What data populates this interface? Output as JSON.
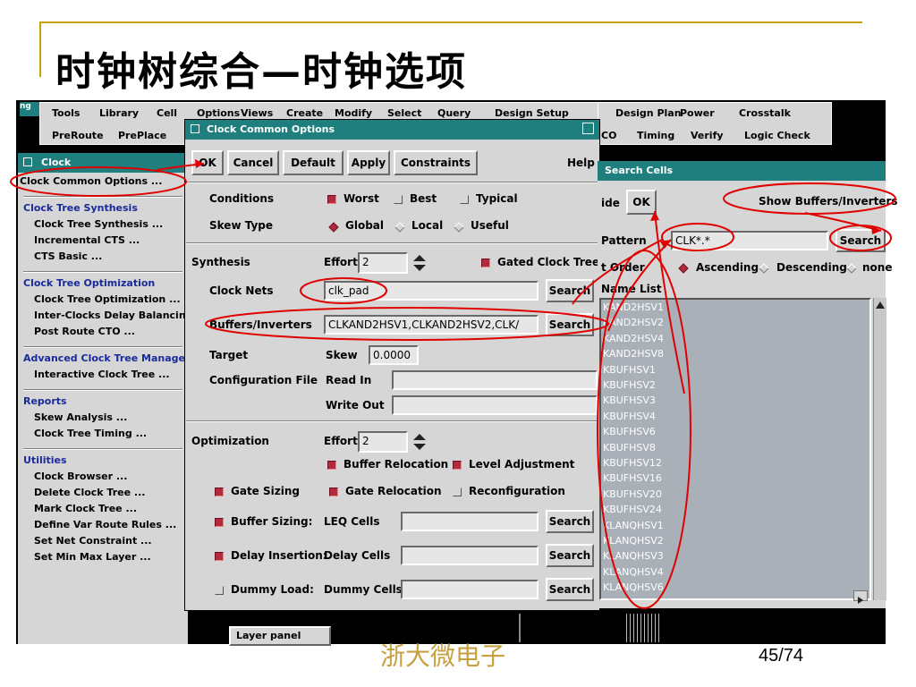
{
  "slide": {
    "title": "时钟树综合—时钟选项",
    "footer": "浙大微电子",
    "page": "45/74"
  },
  "main_menu": {
    "row1": [
      "Tools",
      "Library",
      "Cell",
      "Options",
      "Views",
      "Create",
      "Modify",
      "Select",
      "Query",
      "Design Setup",
      "Design Plan",
      "Power",
      "Crosstalk"
    ],
    "row2": [
      "PreRoute",
      "PrePlace",
      "CO",
      "Timing",
      "Verify",
      "Logic Check"
    ]
  },
  "clock_menu": {
    "title": "Clock",
    "items": [
      {
        "type": "item",
        "label": "Clock Common Options ..."
      },
      {
        "type": "sep"
      },
      {
        "type": "header",
        "label": "Clock Tree Synthesis"
      },
      {
        "type": "item",
        "label": "Clock Tree Synthesis ..."
      },
      {
        "type": "item",
        "label": "Incremental CTS ..."
      },
      {
        "type": "item",
        "label": "CTS Basic ..."
      },
      {
        "type": "sep"
      },
      {
        "type": "header",
        "label": "Clock Tree Optimization"
      },
      {
        "type": "item",
        "label": "Clock Tree Optimization ..."
      },
      {
        "type": "item",
        "label": "Inter-Clocks Delay Balancing"
      },
      {
        "type": "item",
        "label": "Post Route CTO ..."
      },
      {
        "type": "sep"
      },
      {
        "type": "header",
        "label": "Advanced Clock Tree Managen"
      },
      {
        "type": "item",
        "label": "Interactive Clock Tree ..."
      },
      {
        "type": "sep"
      },
      {
        "type": "header",
        "label": "Reports"
      },
      {
        "type": "item",
        "label": "Skew Analysis ..."
      },
      {
        "type": "item",
        "label": "Clock Tree Timing ..."
      },
      {
        "type": "sep"
      },
      {
        "type": "header",
        "label": "Utilities"
      },
      {
        "type": "item",
        "label": "Clock Browser ..."
      },
      {
        "type": "item",
        "label": "Delete Clock Tree ..."
      },
      {
        "type": "item",
        "label": "Mark Clock Tree ..."
      },
      {
        "type": "item",
        "label": "Define Var Route Rules ..."
      },
      {
        "type": "item",
        "label": "Set Net Constraint ..."
      },
      {
        "type": "item",
        "label": "Set Min Max Layer ..."
      }
    ]
  },
  "dialog": {
    "title": "Clock Common Options",
    "buttons": {
      "ok": "OK",
      "cancel": "Cancel",
      "default": "Default",
      "apply": "Apply",
      "constraints": "Constraints",
      "help": "Help"
    },
    "conditions": {
      "label": "Conditions",
      "worst": "Worst",
      "best": "Best",
      "typical": "Typical"
    },
    "skew_type": {
      "label": "Skew Type",
      "global": "Global",
      "local": "Local",
      "useful": "Useful"
    },
    "synthesis": {
      "label": "Synthesis",
      "effort_label": "Effort",
      "effort_value": "2",
      "gated": "Gated Clock Tree"
    },
    "clock_nets": {
      "label": "Clock Nets",
      "value": "clk_pad",
      "search": "Search"
    },
    "buffers": {
      "label": "Buffers/Inverters",
      "value": "CLKAND2HSV1,CLKAND2HSV2,CLK/",
      "search": "Search"
    },
    "target": {
      "label": "Target",
      "skew_label": "Skew",
      "skew_value": "0.0000"
    },
    "config": {
      "label": "Configuration File",
      "read_in": "Read In",
      "write_out": "Write Out"
    },
    "optimization": {
      "label": "Optimization",
      "effort_label": "Effort",
      "effort_value": "2",
      "buffer_relocation": "Buffer Relocation",
      "level_adjustment": "Level Adjustment"
    },
    "gate_sizing": {
      "label": "Gate Sizing",
      "gate_relocation": "Gate Relocation",
      "reconfiguration": "Reconfiguration"
    },
    "buffer_sizing": {
      "label": "Buffer Sizing:",
      "cells": "LEQ Cells",
      "search": "Search"
    },
    "delay_insertion": {
      "label": "Delay Insertion:",
      "cells": "Delay Cells",
      "search": "Search"
    },
    "dummy_load": {
      "label": "Dummy Load:",
      "cells": "Dummy Cells",
      "search": "Search"
    }
  },
  "search_cells": {
    "title": "Search Cells",
    "hide": "ide",
    "ok": "OK",
    "show_buffers": "Show Buffers/Inverters",
    "pattern_label": "Pattern",
    "pattern_value": "CLK*.*",
    "search": "Search",
    "sort_label": "t Order",
    "ascending": "Ascending",
    "descending": "Descending",
    "none": "none",
    "list_label": "Name List",
    "items": [
      "KAND2HSV1",
      "KAND2HSV2",
      "KAND2HSV4",
      "KAND2HSV8",
      "KBUFHSV1",
      "KBUFHSV2",
      "KBUFHSV3",
      "KBUFHSV4",
      "KBUFHSV6",
      "KBUFHSV8",
      "KBUFHSV12",
      "KBUFHSV16",
      "KBUFHSV20",
      "KBUFHSV24",
      "KLANQHSV1",
      "KLANQHSV2",
      "KLANQHSV3",
      "KLANQHSV4",
      "KLANQHSV6"
    ]
  },
  "background_panel": {
    "label": "Layer panel"
  },
  "annotation_color": "#e00000"
}
